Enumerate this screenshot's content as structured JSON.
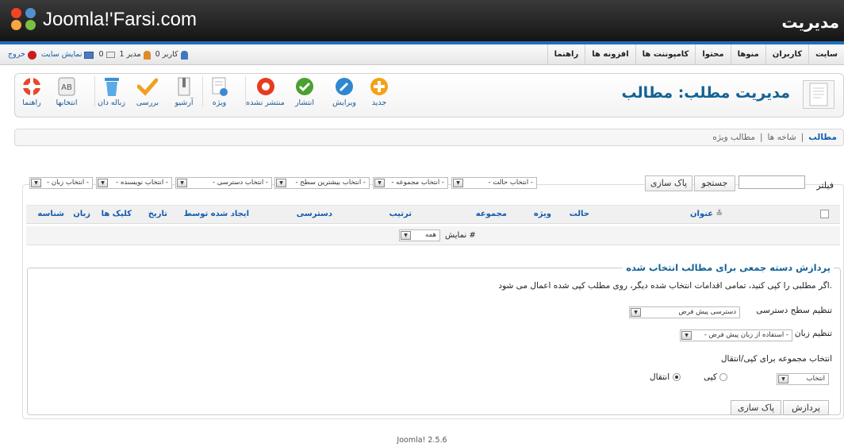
{
  "header": {
    "logo_text": "Joomla!'Farsi.com",
    "title": "مدیریت"
  },
  "menu": {
    "items": [
      "سایت",
      "کاربران",
      "منوها",
      "محتوا",
      "کامپوننت ها",
      "افزونه ها",
      "راهنما"
    ]
  },
  "status": {
    "users": "0 کاربر",
    "admins": "1 مدیر",
    "messages": "0",
    "view_site": "نمایش سایت",
    "logout": "خروج"
  },
  "toolbar": {
    "new": "جدید",
    "edit": "ویرایش",
    "publish": "انتشار",
    "unpublish": "منتشر نشده",
    "featured": "ویژه",
    "archive": "آرشیو",
    "checkin": "بررسی",
    "trash": "زباله دان",
    "options": "انتخابها",
    "help": "راهنما"
  },
  "page": {
    "title": "مدیریت مطلب: مطالب"
  },
  "subnav": {
    "items": [
      "مطالب",
      "شاخه ها",
      "مطالب ویژه"
    ]
  },
  "filters": {
    "label": "فیلتر",
    "search_value": "",
    "search_button": "جستجو",
    "clear_button": "پاک سازی",
    "state": "- انتخاب حالت -",
    "category": "- انتخاب مجموعه -",
    "max_level": "- انتخاب بیشترین سطح -",
    "access": "- انتخاب دسترسی -",
    "author": "- انتخاب نویسنده -",
    "language": "- انتخاب زبان -"
  },
  "table": {
    "columns": [
      "عنوان",
      "حالت",
      "ویژه",
      "مجموعه",
      "ترتیب",
      "دسترسی",
      "ایجاد شده توسط",
      "تاریخ",
      "کلیک ها",
      "زبان",
      "شناسه"
    ],
    "limit_label": "نمایش #",
    "limit_value": "همه"
  },
  "batch": {
    "legend": "پردازش دسته جمعی برای مطالب انتخاب شده",
    "instruction": "اگر مطلبی را کپی کنید، تمامی اقدامات انتخاب شده دیگر، روی مطلب کپی شده اعمال می شود.",
    "access_label": "تنظیم سطح دسترسی",
    "access_value": "دسترسی پیش فرض",
    "language_label": "تنظیم زبان",
    "language_value": "- استفاده از زبان پیش فرض -",
    "move_copy_label": "انتخاب مجموعه برای کپی/انتقال",
    "category_value": "انتخاب",
    "copy_label": "کپی",
    "move_label": "انتقال",
    "process_button": "پردازش",
    "clear_button": "پاک سازی"
  },
  "footer": {
    "version": "Joomla! 2.5.6"
  },
  "colors": {
    "link_blue": "#135cae",
    "accent_blue": "#1f6fb8",
    "header_dark": "#1b1b1b"
  }
}
